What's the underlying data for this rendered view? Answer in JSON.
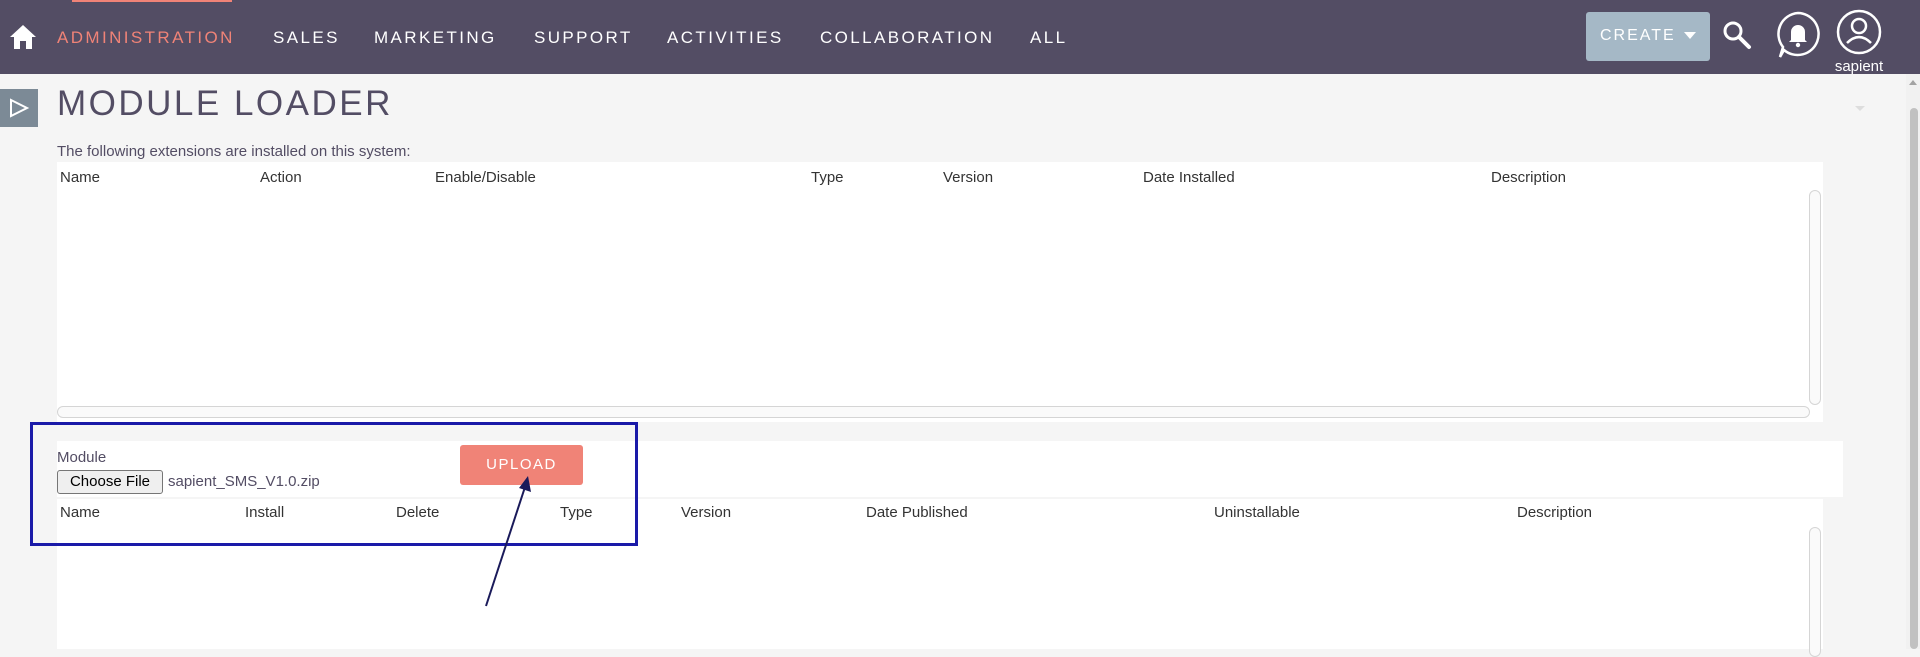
{
  "nav": {
    "items": [
      "ADMINISTRATION",
      "SALES",
      "MARKETING",
      "SUPPORT",
      "ACTIVITIES",
      "COLLABORATION",
      "ALL"
    ],
    "active_index": 0,
    "create_label": "CREATE",
    "username": "sapient"
  },
  "page": {
    "title": "MODULE LOADER",
    "intro": "The following extensions are installed on this system:"
  },
  "installed_table": {
    "columns": [
      "Name",
      "Action",
      "Enable/Disable",
      "Type",
      "Version",
      "Date Installed",
      "Description"
    ],
    "rows": []
  },
  "upload": {
    "module_label": "Module",
    "choose_file_label": "Choose File",
    "file_name": "sapient_SMS_V1.0.zip",
    "upload_label": "UPLOAD"
  },
  "packages_table": {
    "columns": [
      "Name",
      "Install",
      "Delete",
      "Type",
      "Version",
      "Date Published",
      "Uninstallable",
      "Description"
    ],
    "rows": []
  },
  "colors": {
    "nav_bg": "#534d64",
    "accent": "#f08377",
    "create_bg": "#a5b8c6",
    "annotation": "#1a1aa8"
  },
  "icons": [
    "home-icon",
    "search-icon",
    "bell-icon",
    "user-icon",
    "play-icon"
  ]
}
